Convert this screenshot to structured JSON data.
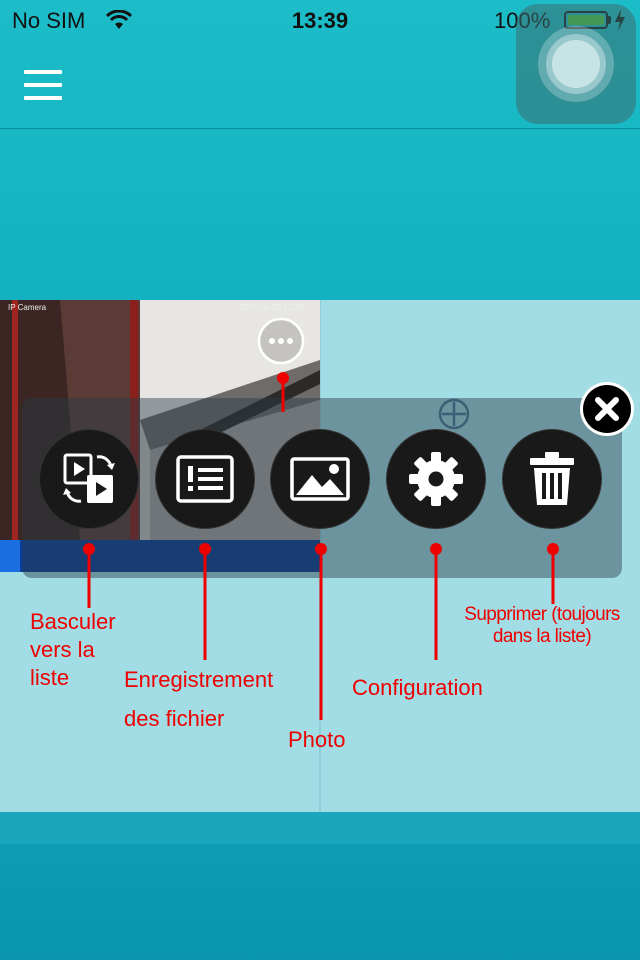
{
  "status_bar": {
    "carrier": "No SIM",
    "time": "13:39",
    "battery_percent": "100%",
    "battery_level": 1.0
  },
  "nav": {
    "menu_icon": "hamburger-menu-icon"
  },
  "toolbar": {
    "buttons": [
      {
        "icon": "switch-view-icon"
      },
      {
        "icon": "record-list-icon"
      },
      {
        "icon": "photo-icon"
      },
      {
        "icon": "gear-icon"
      },
      {
        "icon": "trash-icon"
      }
    ],
    "close_icon": "close-icon",
    "add_icon": "add-circle-icon"
  },
  "camera_tile": {
    "more_icon": "more-dots-icon",
    "selected": true
  },
  "annotations": {
    "switch": "Basculer vers la liste",
    "records_line1": "Enregistrement",
    "records_line2": "des fichier",
    "photo": "Photo",
    "config": "Configuration",
    "delete": "Supprimer (toujours dans la liste)"
  },
  "colors": {
    "background": "#1ab8c4",
    "grid": "#a2dde6",
    "annotation": "#e00000",
    "selected_bar": "#0c3f9c"
  }
}
